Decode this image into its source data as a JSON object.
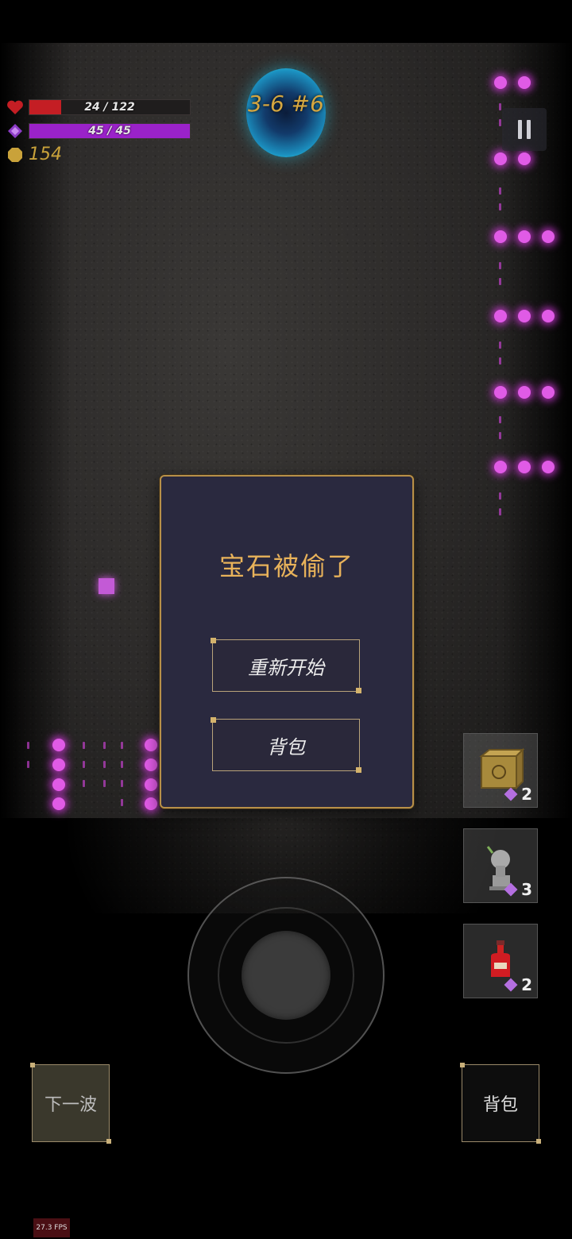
{
  "hud": {
    "health": {
      "current": 24,
      "max": 122,
      "label": "24 / 122",
      "color": "#c41e24"
    },
    "mana": {
      "current": 45,
      "max": 45,
      "label": "45 / 45",
      "color": "#9a22c9"
    },
    "gold": "154"
  },
  "level": {
    "label": "3-6 #6"
  },
  "pause_icon": "pause-icon",
  "dialog": {
    "title": "宝石被偷了",
    "restart_label": "重新开始",
    "backpack_label": "背包"
  },
  "items": [
    {
      "icon": "crate-icon",
      "count": "2"
    },
    {
      "icon": "statue-icon",
      "count": "3"
    },
    {
      "icon": "potion-icon",
      "count": "2"
    }
  ],
  "buttons": {
    "next_wave": "下一波",
    "backpack": "背包"
  },
  "fps": "27.3 FPS",
  "colors": {
    "accent_gold": "#e8b25a",
    "rune_magenta": "#e05be6"
  }
}
